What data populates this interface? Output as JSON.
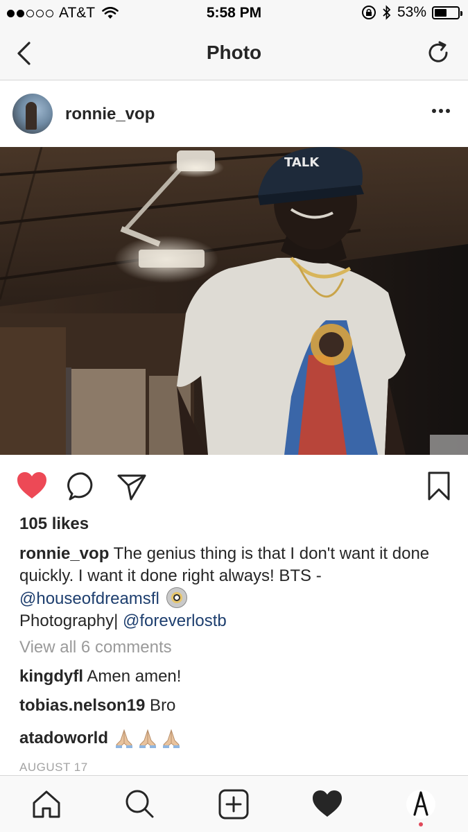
{
  "status_bar": {
    "carrier": "AT&T",
    "time": "5:58 PM",
    "battery": "53%",
    "battery_level": 0.53
  },
  "nav": {
    "title": "Photo",
    "back_icon": "chevron-left-icon",
    "refresh_icon": "refresh-icon"
  },
  "post": {
    "username": "ronnie_vop",
    "likes": "105 likes",
    "caption": {
      "username": "ronnie_vop",
      "text": " The genius thing is that I don't want it done quickly. I want it done right always! BTS - ",
      "mention1": "@houseofdreamsfl",
      "text2": "Photography| ",
      "mention2": "@foreverlostb"
    },
    "view_all_comments": "View all 6 comments",
    "comments": [
      {
        "user": "kingdyfl",
        "text": " Amen amen!"
      },
      {
        "user": "tobias.nelson19",
        "text": " Bro"
      },
      {
        "user": "atadoworld",
        "text": ""
      }
    ],
    "date": "AUGUST 17",
    "photo_hat_text": "TALK"
  },
  "colors": {
    "like_red": "#ed4956",
    "link_blue": "#1d3e6e",
    "text": "#262626",
    "muted": "#9a9a9a"
  },
  "tab_bar": {
    "items": [
      "home-icon",
      "search-icon",
      "add-post-icon",
      "activity-heart-icon",
      "profile-icon"
    ]
  }
}
